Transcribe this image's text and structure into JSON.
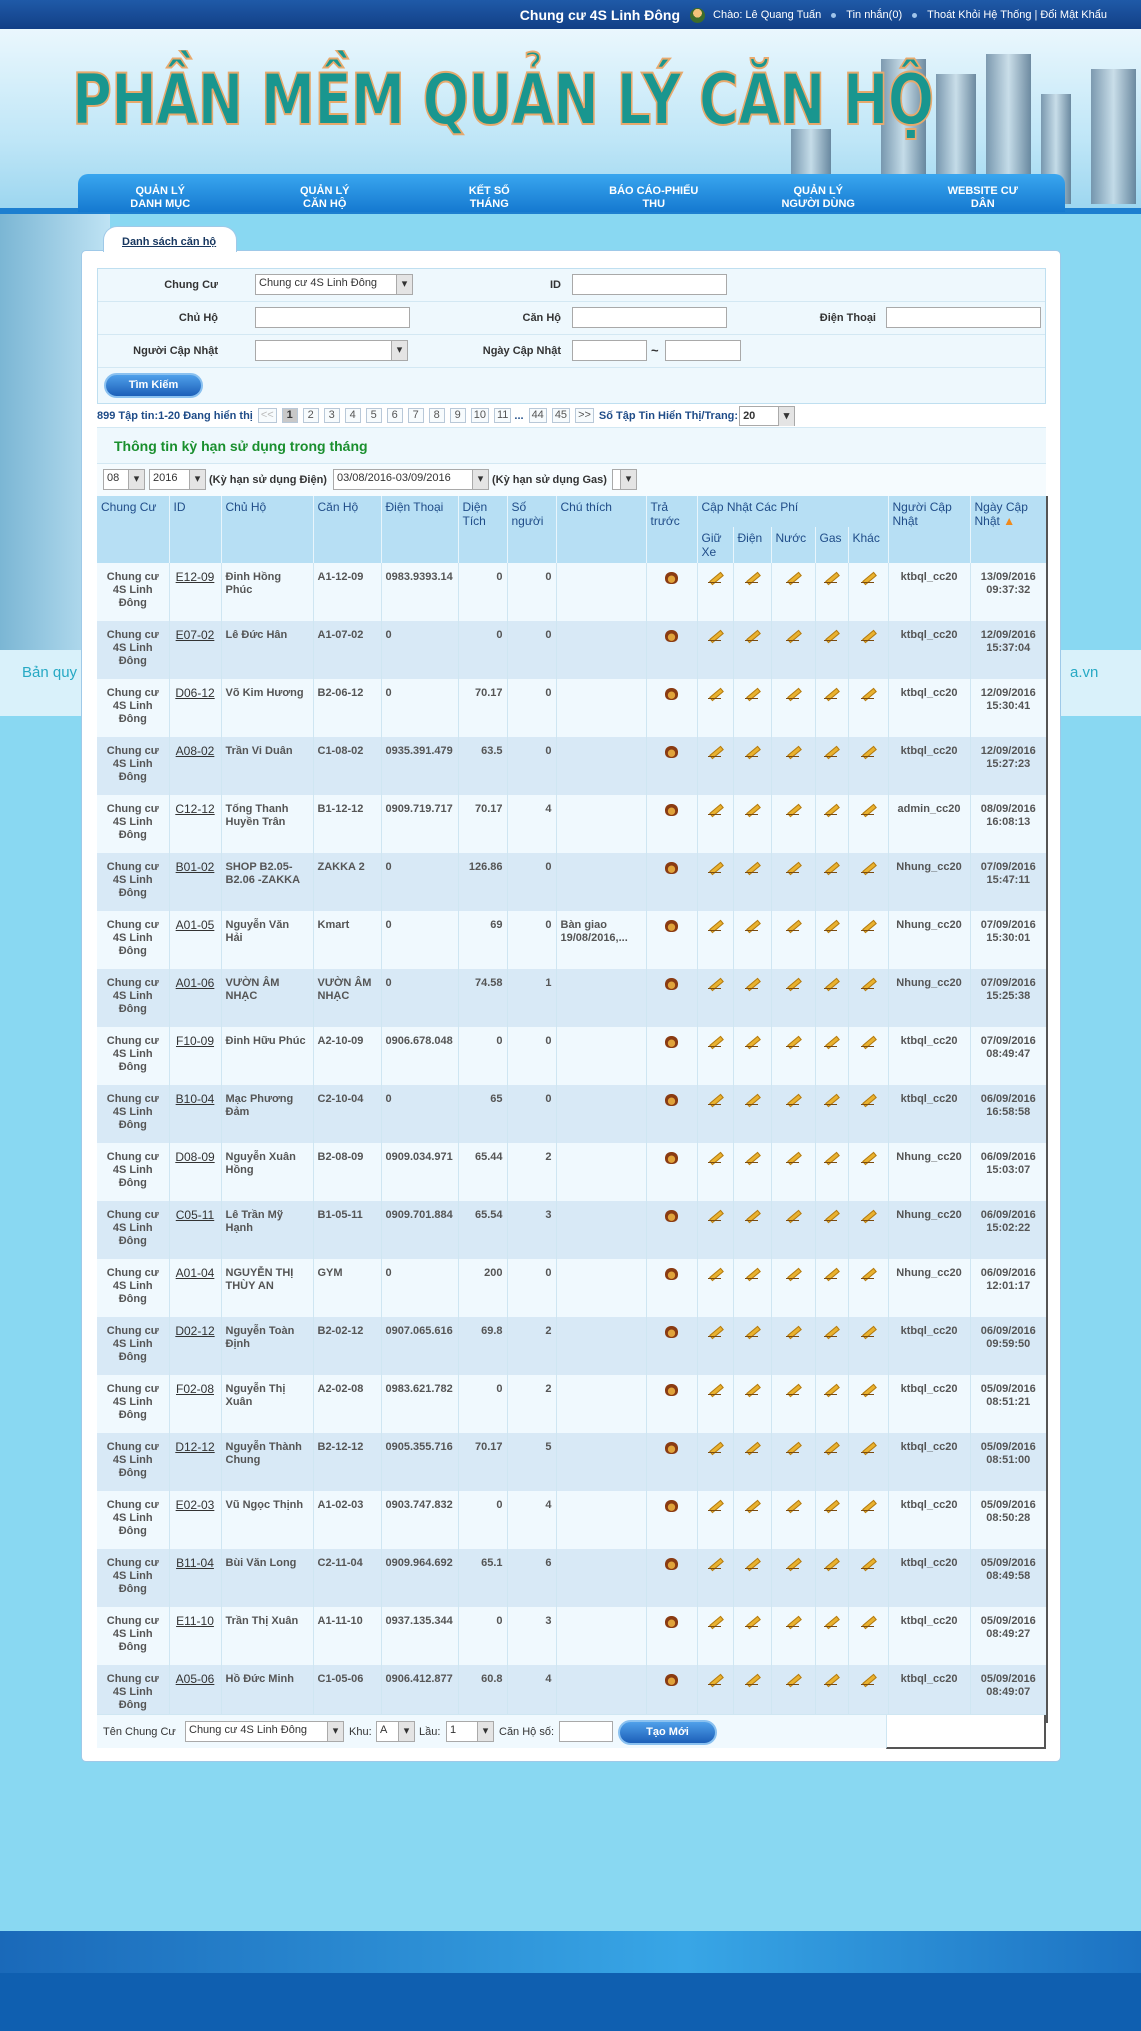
{
  "topbar": {
    "site_name": "Chung cư 4S Linh Đông",
    "greeting": "Chào: Lê Quang Tuấn",
    "messages": "Tin nhắn(0)",
    "logout": "Thoát Khỏi Hệ Thống",
    "separator": "|",
    "change_password": "Đổi Mật Khẩu"
  },
  "header": {
    "logo_title": "PHẦN MỀM QUẢN LÝ CĂN HỘ"
  },
  "copyright": {
    "left": "Bản quy",
    "right": "a.vn"
  },
  "nav": {
    "items": [
      {
        "label": "QUẢN LÝ\nDANH MỤC"
      },
      {
        "label": "QUẢN LÝ\nCĂN HỘ"
      },
      {
        "label": "KẾT SỔ\nTHÁNG"
      },
      {
        "label": "BÁO CÁO-PHIẾU\nTHU"
      },
      {
        "label": "QUẢN LÝ\nNGƯỜI DÙNG"
      },
      {
        "label": "WEBSITE CƯ\nDÂN"
      }
    ]
  },
  "tab": {
    "label": "Danh sách căn hộ"
  },
  "search": {
    "chung_cu_label": "Chung Cư",
    "chung_cu_value": "Chung cư 4S Linh Đông",
    "id_label": "ID",
    "id_value": "",
    "chu_ho_label": "Chủ Hộ",
    "chu_ho_value": "",
    "can_ho_label": "Căn Hộ",
    "can_ho_value": "",
    "dien_thoai_label": "Điện Thoại",
    "dien_thoai_value": "",
    "nguoi_cap_nhat_label": "Người Cập Nhật",
    "nguoi_cap_nhat_value": "",
    "ngay_cap_nhat_label": "Ngày Cập Nhật",
    "date_from": "",
    "date_to": "",
    "tilde": "~",
    "search_button": "Tìm Kiếm"
  },
  "pager": {
    "summary": "899 Tập tin:1-20 Đang hiển thị",
    "prev": "<<",
    "pages": [
      "1",
      "2",
      "3",
      "4",
      "5",
      "6",
      "7",
      "8",
      "9",
      "10",
      "11"
    ],
    "ellipsis": "...",
    "last_pages": [
      "44",
      "45"
    ],
    "next": ">>",
    "per_page_label": "Số Tập Tin Hiển Thị/Trang:",
    "per_page_value": "20"
  },
  "notice": {
    "text": "Thông tin kỳ hạn sử dụng trong tháng"
  },
  "period": {
    "month": "08",
    "year": "2016",
    "electric_label": "(Kỳ hạn sử dụng Điện)",
    "electric_range": "03/08/2016-03/09/2016",
    "gas_label": "(Kỳ hạn sử dụng Gas)",
    "gas_value": ""
  },
  "table": {
    "headers": {
      "chung_cu": "Chung Cư",
      "id": "ID",
      "chu_ho": "Chủ Hộ",
      "can_ho": "Căn Hộ",
      "dien_thoai": "Điện Thoại",
      "dien_tich": "Diện Tích",
      "so_nguoi": "Số người",
      "chu_thich": "Chú thích",
      "tra_truoc": "Trả trước",
      "cap_nhat_cac_phi": "Cập Nhật Các Phí",
      "giu_xe": "Giữ Xe",
      "dien": "Điện",
      "nuoc": "Nước",
      "gas": "Gas",
      "khac": "Khác",
      "nguoi_cap_nhat": "Người Cập Nhật",
      "ngay_cap_nhat": "Ngày Cập Nhật"
    },
    "rows": [
      {
        "chung_cu": "Chung cư 4S Linh Đông",
        "id": "E12-09",
        "chu_ho": "Đinh Hồng Phúc",
        "can_ho": "A1-12-09",
        "phone": "0983.9393.14",
        "area": "0",
        "people": "0",
        "note": "",
        "user": "ktbql_cc20",
        "date": "13/09/2016",
        "time": "09:37:32"
      },
      {
        "chung_cu": "Chung cư 4S Linh Đông",
        "id": "E07-02",
        "chu_ho": "Lê Đức Hân",
        "can_ho": "A1-07-02",
        "phone": "0",
        "area": "0",
        "people": "0",
        "note": "",
        "user": "ktbql_cc20",
        "date": "12/09/2016",
        "time": "15:37:04"
      },
      {
        "chung_cu": "Chung cư 4S Linh Đông",
        "id": "D06-12",
        "chu_ho": "Võ Kim Hương",
        "can_ho": "B2-06-12",
        "phone": "0",
        "area": "70.17",
        "people": "0",
        "note": "",
        "user": "ktbql_cc20",
        "date": "12/09/2016",
        "time": "15:30:41"
      },
      {
        "chung_cu": "Chung cư 4S Linh Đông",
        "id": "A08-02",
        "chu_ho": "Trần Vi Duân",
        "can_ho": "C1-08-02",
        "phone": "0935.391.479",
        "area": "63.5",
        "people": "0",
        "note": "",
        "user": "ktbql_cc20",
        "date": "12/09/2016",
        "time": "15:27:23"
      },
      {
        "chung_cu": "Chung cư 4S Linh Đông",
        "id": "C12-12",
        "chu_ho": "Tống Thanh Huyền Trân",
        "can_ho": "B1-12-12",
        "phone": "0909.719.717",
        "area": "70.17",
        "people": "4",
        "note": "",
        "user": "admin_cc20",
        "date": "08/09/2016",
        "time": "16:08:13"
      },
      {
        "chung_cu": "Chung cư 4S Linh Đông",
        "id": "B01-02",
        "chu_ho": "SHOP B2.05-B2.06 -ZAKKA",
        "can_ho": "ZAKKA 2",
        "phone": "0",
        "area": "126.86",
        "people": "0",
        "note": "",
        "user": "Nhung_cc20",
        "date": "07/09/2016",
        "time": "15:47:11"
      },
      {
        "chung_cu": "Chung cư 4S Linh Đông",
        "id": "A01-05",
        "chu_ho": "Nguyễn Văn Hải",
        "can_ho": "Kmart",
        "phone": "0",
        "area": "69",
        "people": "0",
        "note": "Bàn giao 19/08/2016,...",
        "user": "Nhung_cc20",
        "date": "07/09/2016",
        "time": "15:30:01"
      },
      {
        "chung_cu": "Chung cư 4S Linh Đông",
        "id": "A01-06",
        "chu_ho": "VƯỜN ÂM NHẠC",
        "can_ho": "VƯỜN ÂM NHẠC",
        "phone": "0",
        "area": "74.58",
        "people": "1",
        "note": "",
        "user": "Nhung_cc20",
        "date": "07/09/2016",
        "time": "15:25:38"
      },
      {
        "chung_cu": "Chung cư 4S Linh Đông",
        "id": "F10-09",
        "chu_ho": "Đinh Hữu Phúc",
        "can_ho": "A2-10-09",
        "phone": "0906.678.048",
        "area": "0",
        "people": "0",
        "note": "",
        "user": "ktbql_cc20",
        "date": "07/09/2016",
        "time": "08:49:47"
      },
      {
        "chung_cu": "Chung cư 4S Linh Đông",
        "id": "B10-04",
        "chu_ho": "Mạc Phương Đảm",
        "can_ho": "C2-10-04",
        "phone": "0",
        "area": "65",
        "people": "0",
        "note": "",
        "user": "ktbql_cc20",
        "date": "06/09/2016",
        "time": "16:58:58"
      },
      {
        "chung_cu": "Chung cư 4S Linh Đông",
        "id": "D08-09",
        "chu_ho": "Nguyễn Xuân Hồng",
        "can_ho": "B2-08-09",
        "phone": "0909.034.971",
        "area": "65.44",
        "people": "2",
        "note": "",
        "user": "Nhung_cc20",
        "date": "06/09/2016",
        "time": "15:03:07"
      },
      {
        "chung_cu": "Chung cư 4S Linh Đông",
        "id": "C05-11",
        "chu_ho": "Lê Trần Mỹ Hạnh",
        "can_ho": "B1-05-11",
        "phone": "0909.701.884",
        "area": "65.54",
        "people": "3",
        "note": "",
        "user": "Nhung_cc20",
        "date": "06/09/2016",
        "time": "15:02:22"
      },
      {
        "chung_cu": "Chung cư 4S Linh Đông",
        "id": "A01-04",
        "chu_ho": "NGUYỄN THỊ THÙY AN",
        "can_ho": "GYM",
        "phone": "0",
        "area": "200",
        "people": "0",
        "note": "",
        "user": "Nhung_cc20",
        "date": "06/09/2016",
        "time": "12:01:17"
      },
      {
        "chung_cu": "Chung cư 4S Linh Đông",
        "id": "D02-12",
        "chu_ho": "Nguyễn Toàn Định",
        "can_ho": "B2-02-12",
        "phone": "0907.065.616",
        "area": "69.8",
        "people": "2",
        "note": "",
        "user": "ktbql_cc20",
        "date": "06/09/2016",
        "time": "09:59:50"
      },
      {
        "chung_cu": "Chung cư 4S Linh Đông",
        "id": "F02-08",
        "chu_ho": "Nguyễn Thị Xuân",
        "can_ho": "A2-02-08",
        "phone": "0983.621.782",
        "area": "0",
        "people": "2",
        "note": "",
        "user": "ktbql_cc20",
        "date": "05/09/2016",
        "time": "08:51:21"
      },
      {
        "chung_cu": "Chung cư 4S Linh Đông",
        "id": "D12-12",
        "chu_ho": "Nguyễn Thành Chung",
        "can_ho": "B2-12-12",
        "phone": "0905.355.716",
        "area": "70.17",
        "people": "5",
        "note": "",
        "user": "ktbql_cc20",
        "date": "05/09/2016",
        "time": "08:51:00"
      },
      {
        "chung_cu": "Chung cư 4S Linh Đông",
        "id": "E02-03",
        "chu_ho": "Vũ Ngọc Thịnh",
        "can_ho": "A1-02-03",
        "phone": "0903.747.832",
        "area": "0",
        "people": "4",
        "note": "",
        "user": "ktbql_cc20",
        "date": "05/09/2016",
        "time": "08:50:28"
      },
      {
        "chung_cu": "Chung cư 4S Linh Đông",
        "id": "B11-04",
        "chu_ho": "Bùi Văn Long",
        "can_ho": "C2-11-04",
        "phone": "0909.964.692",
        "area": "65.1",
        "people": "6",
        "note": "",
        "user": "ktbql_cc20",
        "date": "05/09/2016",
        "time": "08:49:58"
      },
      {
        "chung_cu": "Chung cư 4S Linh Đông",
        "id": "E11-10",
        "chu_ho": "Trần Thị Xuân",
        "can_ho": "A1-11-10",
        "phone": "0937.135.344",
        "area": "0",
        "people": "3",
        "note": "",
        "user": "ktbql_cc20",
        "date": "05/09/2016",
        "time": "08:49:27"
      },
      {
        "chung_cu": "Chung cư 4S Linh Đông",
        "id": "A05-06",
        "chu_ho": "Hồ Đức Minh",
        "can_ho": "C1-05-06",
        "phone": "0906.412.877",
        "area": "60.8",
        "people": "4",
        "note": "",
        "user": "ktbql_cc20",
        "date": "05/09/2016",
        "time": "08:49:07"
      }
    ]
  },
  "footer_form": {
    "ten_chung_cu_label": "Tên Chung Cư",
    "ten_chung_cu_value": "Chung cư 4S Linh Đông",
    "khu_label": "Khu:",
    "khu_value": "A",
    "lau_label": "Lầu:",
    "lau_value": "1",
    "can_ho_so_label": "Căn Hộ số:",
    "can_ho_so_value": "",
    "create_button": "Tạo Mới"
  }
}
